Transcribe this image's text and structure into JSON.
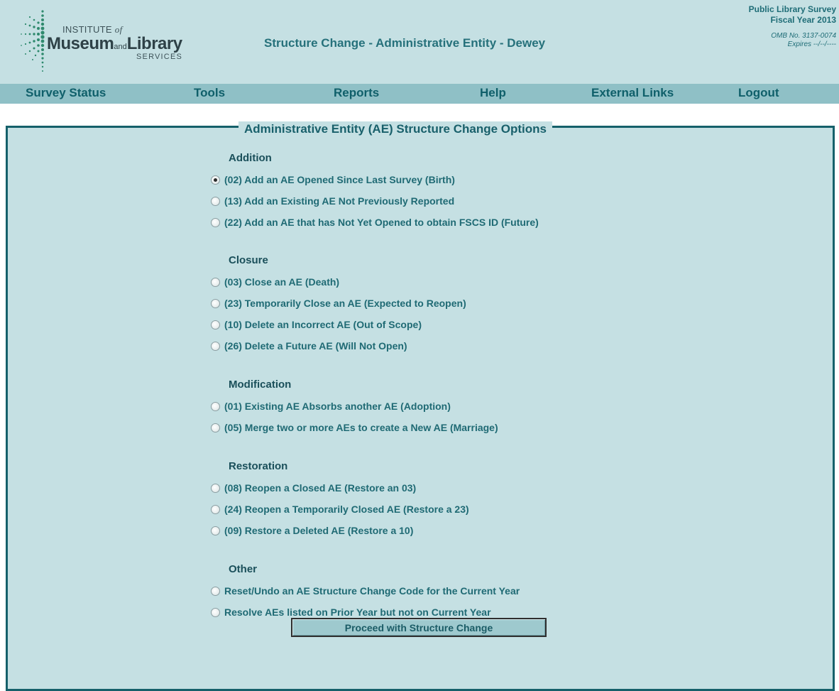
{
  "header": {
    "logo": {
      "institute": "INSTITUTE",
      "of": "of",
      "museum": "Museum",
      "and": "and",
      "library": "Library",
      "services": "SERVICES"
    },
    "title": "Structure Change - Administrative Entity - Dewey",
    "survey_name": "Public Library Survey",
    "fiscal_year": "Fiscal Year 2013",
    "omb": "OMB No. 3137-0074",
    "expires": "Expires --/--/----"
  },
  "nav": [
    {
      "label": "Survey Status"
    },
    {
      "label": "Tools"
    },
    {
      "label": "Reports"
    },
    {
      "label": "Help"
    },
    {
      "label": "External Links"
    },
    {
      "label": "Logout"
    }
  ],
  "panel": {
    "title": "Administrative Entity (AE) Structure Change Options",
    "sections": [
      {
        "heading": "Addition",
        "options": [
          {
            "label": "(02) Add an AE Opened Since Last Survey (Birth)",
            "checked": true
          },
          {
            "label": "(13) Add an Existing AE Not Previously Reported",
            "checked": false
          },
          {
            "label": "(22) Add an AE that has Not Yet Opened to obtain FSCS ID (Future)",
            "checked": false
          }
        ]
      },
      {
        "heading": "Closure",
        "options": [
          {
            "label": "(03) Close an AE (Death)",
            "checked": false
          },
          {
            "label": "(23) Temporarily Close an AE (Expected to Reopen)",
            "checked": false
          },
          {
            "label": "(10) Delete an Incorrect AE (Out of Scope)",
            "checked": false
          },
          {
            "label": "(26) Delete a Future AE (Will Not Open)",
            "checked": false
          }
        ]
      },
      {
        "heading": "Modification",
        "options": [
          {
            "label": "(01) Existing AE Absorbs another AE (Adoption)",
            "checked": false
          },
          {
            "label": "(05) Merge two or more AEs to create a New AE (Marriage)",
            "checked": false
          }
        ]
      },
      {
        "heading": "Restoration",
        "options": [
          {
            "label": "(08) Reopen a Closed AE (Restore an 03)",
            "checked": false
          },
          {
            "label": "(24) Reopen a Temporarily Closed AE (Restore a 23)",
            "checked": false
          },
          {
            "label": "(09) Restore a Deleted AE (Restore a 10)",
            "checked": false
          }
        ]
      },
      {
        "heading": "Other",
        "options": [
          {
            "label": "Reset/Undo an AE Structure Change Code for the Current Year",
            "checked": false
          },
          {
            "label": "Resolve AEs listed on Prior Year but not on Current Year",
            "checked": false
          }
        ]
      }
    ],
    "proceed_label": "Proceed with Structure Change"
  },
  "colors": {
    "background": "#c5e0e3",
    "nav": "#8fc0c6",
    "accent": "#15606a",
    "text": "#1f6a74"
  }
}
